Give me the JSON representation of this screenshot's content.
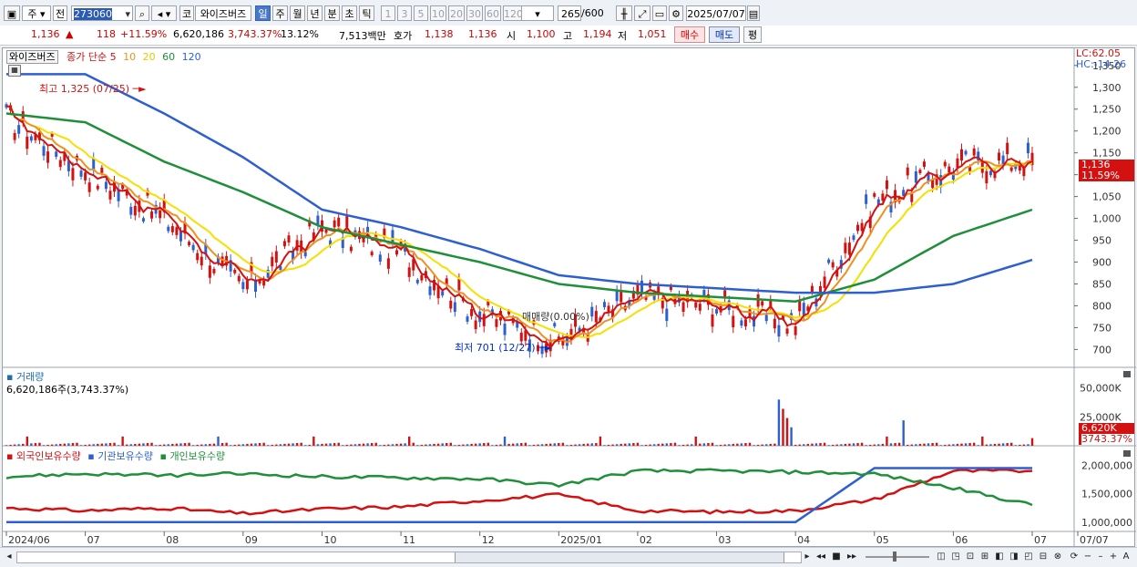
{
  "toolbar": {
    "period_primary": "주",
    "period_secondary": "전",
    "code": "273060",
    "market_tag": "코",
    "stock_name": "와이즈버즈",
    "periods": [
      "일",
      "주",
      "월",
      "년",
      "분",
      "초",
      "틱"
    ],
    "intervals": [
      "1",
      "3",
      "5",
      "10",
      "20",
      "30",
      "60",
      "120"
    ],
    "count": "265",
    "count_total": "/600",
    "date": "2025/07/07"
  },
  "quote": {
    "price": "1,136",
    "change_arrow": "▲",
    "change": "118",
    "change_pct": "+11.59%",
    "volume": "6,620,186",
    "volume_ratio": "3,743.37%",
    "turnover": "13.12%",
    "amount": "7,513백만",
    "ask_label": "호가",
    "ask": "1,138",
    "bid": "1,136",
    "open_label": "시",
    "open": "1,100",
    "high_label": "고",
    "high": "1,194",
    "low_label": "저",
    "low": "1,051",
    "buy_btn": "매수",
    "sell_btn": "매도",
    "eval_btn": "평"
  },
  "main_legend": {
    "stock": "와이즈버즈",
    "price_label": "종가 단순",
    "ma": [
      "5",
      "10",
      "20",
      "60",
      "120"
    ],
    "ma_colors": [
      "#d41111",
      "#f0901e",
      "#f5e000",
      "#1f8f3a",
      "#2e5fd0"
    ]
  },
  "info_right": {
    "lc": "LC:62.05",
    "hc": "HC:-14.26"
  },
  "price_axis": [
    "1,350",
    "1,300",
    "1,250",
    "1,200",
    "1,150",
    "1,100",
    "1,050",
    "1,000",
    "950",
    "900",
    "850",
    "800",
    "750",
    "700"
  ],
  "price_badge": {
    "price": "1,136",
    "pct": "11.59%"
  },
  "annotations": {
    "high": "최고 1,325 (07/25)",
    "low": "최저 701 (12/27)",
    "mid": "매매량(0.00%)"
  },
  "volume_panel": {
    "title": "거래량",
    "value": "6,620,186주(3,743.37%)",
    "axis": [
      "50,000K",
      "25,000K"
    ],
    "badge": "6,620K",
    "badge2": "3743.37%"
  },
  "holding_panel": {
    "series": [
      "외국인보유수량",
      "기관보유수량",
      "개인보유수량"
    ],
    "colors": [
      "#d41111",
      "#2e5fd0",
      "#1f8f3a"
    ],
    "axis": [
      "2,000,000",
      "1,500,000",
      "1,000,000"
    ]
  },
  "x_axis": [
    "2024/06",
    "07",
    "08",
    "09",
    "10",
    "11",
    "12",
    "2025/01",
    "02",
    "03",
    "04",
    "05",
    "06",
    "07",
    "07/07"
  ],
  "icons": [
    "window-icon",
    "dropdown-icon",
    "search-icon",
    "sound-icon",
    "candle-icon",
    "compare-icon",
    "save-icon",
    "gear-icon",
    "calendar-icon",
    "grid-icon"
  ],
  "chart_data": {
    "type": "line",
    "title": "",
    "x": [
      "2024/06",
      "07",
      "08",
      "09",
      "10",
      "11",
      "12",
      "2025/01",
      "02",
      "03",
      "04",
      "05",
      "06",
      "07"
    ],
    "series": [
      {
        "name": "종가",
        "values": [
          1230,
          1110,
          1000,
          840,
          980,
          920,
          780,
          720,
          820,
          800,
          760,
          1040,
          1120,
          1136
        ]
      },
      {
        "name": "120",
        "values": [
          1330,
          1330,
          1240,
          1140,
          1020,
          980,
          930,
          870,
          850,
          840,
          830,
          830,
          850,
          905
        ]
      },
      {
        "name": "60",
        "values": [
          1240,
          1220,
          1130,
          1060,
          980,
          940,
          900,
          850,
          830,
          820,
          810,
          860,
          960,
          1020
        ]
      },
      {
        "name": "외국인보유수량",
        "values": [
          1250000,
          1200000,
          1250000,
          1150000,
          1230000,
          1270000,
          1380000,
          1480000,
          1200000,
          1180000,
          1200000,
          1400000,
          1900000,
          1900000
        ]
      },
      {
        "name": "기관보유수량",
        "values": [
          1000000,
          1000000,
          1000000,
          1000000,
          1000000,
          1000000,
          1000000,
          1000000,
          1000000,
          1000000,
          1000000,
          1950000,
          1950000,
          1950000
        ]
      },
      {
        "name": "개인보유수량",
        "values": [
          1800000,
          1850000,
          1820000,
          1850000,
          1800000,
          1780000,
          1760000,
          1650000,
          1900000,
          1900000,
          1880000,
          1850000,
          1600000,
          1300000
        ]
      }
    ],
    "ylim": [
      680,
      1360
    ]
  }
}
